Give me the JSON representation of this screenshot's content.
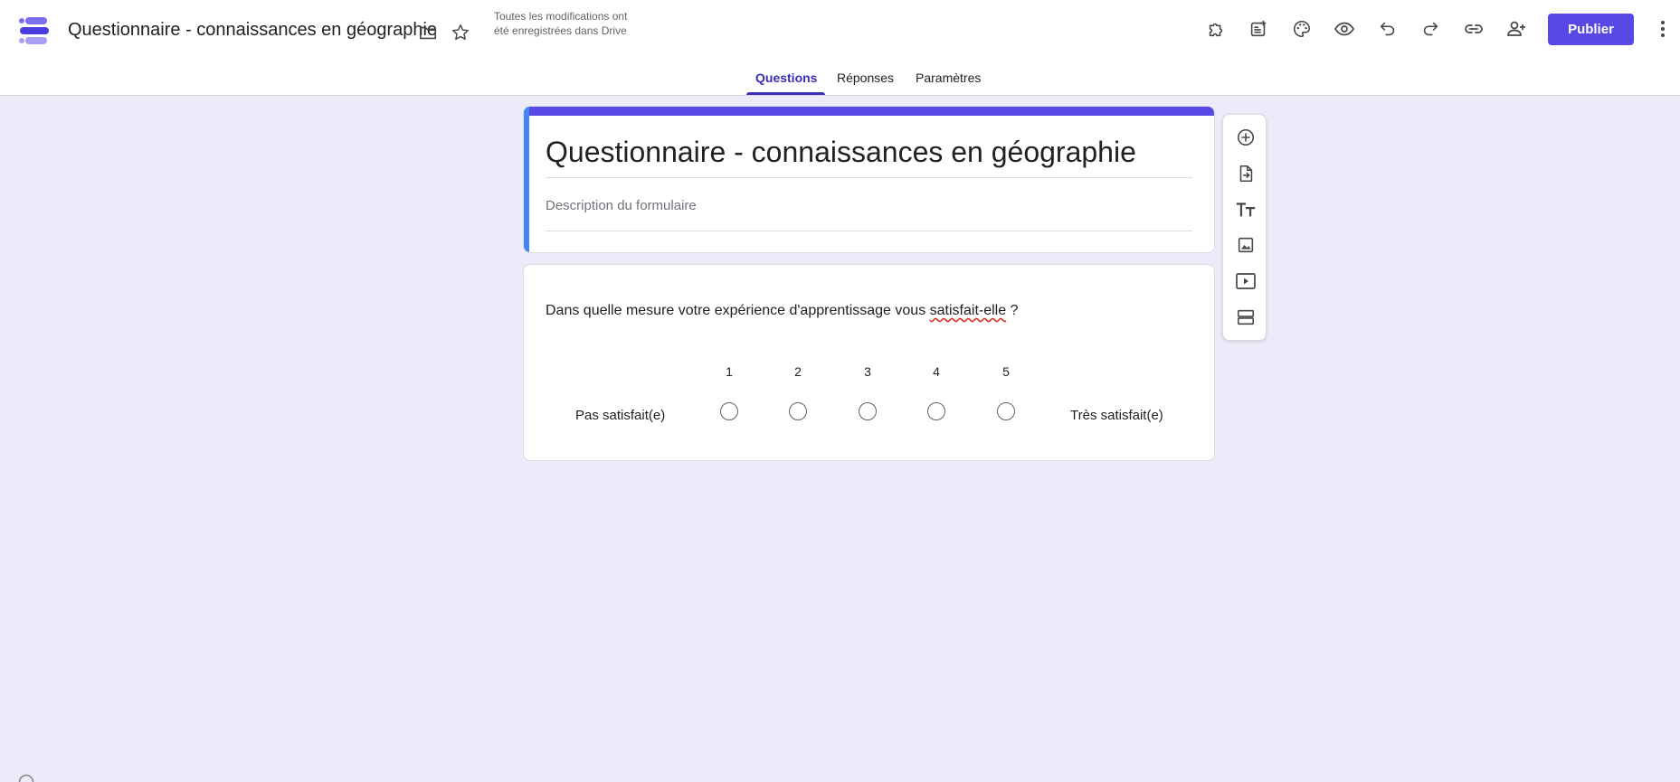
{
  "header": {
    "doc_title": "Questionnaire - connaissances en géographie",
    "save_status": "Toutes les modifications ont été enregistrées dans Drive",
    "publish_label": "Publier",
    "icons": [
      "folder-icon",
      "star-icon",
      "addons-icon",
      "template-icon",
      "palette-icon",
      "preview-icon",
      "undo-icon",
      "redo-icon",
      "link-icon",
      "add-collaborator-icon",
      "more-vert-icon"
    ]
  },
  "tabs": [
    {
      "label": "Questions",
      "active": true
    },
    {
      "label": "Réponses",
      "active": false
    },
    {
      "label": "Paramètres",
      "active": false
    }
  ],
  "form": {
    "title": "Questionnaire - connaissances en géographie",
    "description_placeholder": "Description du formulaire"
  },
  "question": {
    "text_before": "Dans quelle mesure votre expérience d'apprentissage vous ",
    "text_misspelled": "satisfait-elle",
    "text_after": " ?",
    "scale": [
      "1",
      "2",
      "3",
      "4",
      "5"
    ],
    "low_label": "Pas satisfait(e)",
    "high_label": "Très satisfait(e)"
  },
  "side_toolbar": [
    "add-question-icon",
    "import-questions-icon",
    "add-title-icon",
    "add-image-icon",
    "add-video-icon",
    "add-section-icon"
  ],
  "colors": {
    "accent": "#5848e5",
    "tab_active": "#3a2ebd",
    "left_bar": "#4285f4",
    "background": "#edebf9"
  }
}
